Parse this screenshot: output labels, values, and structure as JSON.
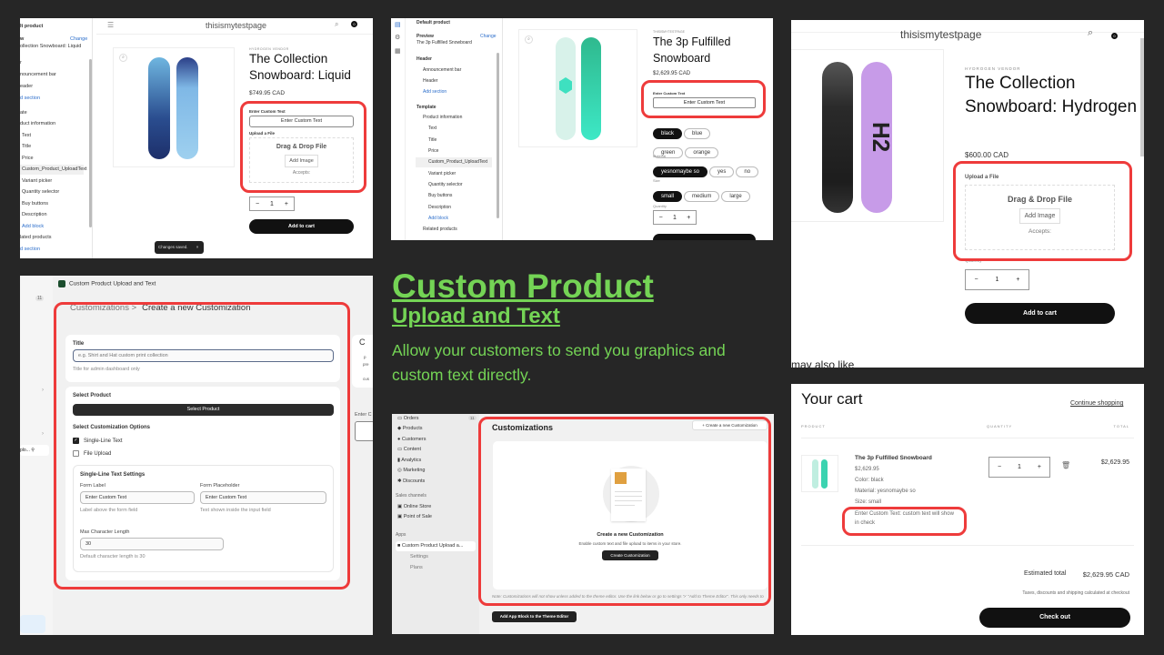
{
  "headline": {
    "title": "Custom Product",
    "subtitle": "Upload and Text",
    "description": "Allow your customers to send you graphics and custom text directly.",
    "accent_color": "#74d455"
  },
  "panel1": {
    "sidebar": {
      "heading": "lt product",
      "preview_label": "w",
      "change": "Change",
      "preview_value": "ollection Snowboard: Liquid",
      "header": "r",
      "items": [
        "nouncement bar",
        "eader",
        "d section",
        "ate",
        "duct information",
        "Text",
        "Title",
        "Price",
        "Custom_Product_UploadText",
        "Variant picker",
        "Quantity selector",
        "Buy buttons",
        "Description",
        "Add block",
        "lated products",
        "d section"
      ]
    },
    "store_name": "thisismytestpage",
    "cart_count": "0",
    "vendor": "HYDROGEN VENDOR",
    "product_title": "The Collection Snowboard: Liquid",
    "price": "$749.95 CAD",
    "custom_text_label": "Enter Custom Text",
    "custom_text_placeholder": "Enter Custom Text",
    "upload_label": "Upload a File",
    "drop_heading": "Drag & Drop File",
    "add_image": "Add Image",
    "accepts": "Accepts:",
    "quantity": "1",
    "minus": "−",
    "plus": "+",
    "add_to_cart": "Add to cart",
    "toast": "Changes saved.",
    "toast_close": "×"
  },
  "panel2": {
    "sidebar": {
      "heading": "Default product",
      "preview_label": "Preview",
      "change": "Change",
      "preview_value": "The 3p Fulfilled Snowboard",
      "header_group": "Header",
      "header_items": [
        "Announcement bar",
        "Header"
      ],
      "add_section": "Add section",
      "template_group": "Template",
      "template_parent": "Product information",
      "blocks": [
        "Text",
        "Title",
        "Price",
        "Custom_Product_UploadText",
        "Variant picker",
        "Quantity selector",
        "Buy buttons",
        "Description"
      ],
      "add_block": "Add block",
      "related": "Related products"
    },
    "vendor": "THISISMYTESTPAGE",
    "product_title": "The 3p Fulfilled Snowboard",
    "price": "$2,629.95 CAD",
    "custom_text_label": "Enter Custom Text",
    "custom_text_placeholder": "Enter Custom Text",
    "color_label": "Color",
    "colors": [
      "black",
      "blue",
      "green",
      "orange"
    ],
    "selected_color": "black",
    "material_label": "Material",
    "materials": [
      "yesnomaybe so",
      "yes",
      "no"
    ],
    "selected_material": "yesnomaybe so",
    "size_label": "Size",
    "sizes": [
      "small",
      "medium",
      "large"
    ],
    "selected_size": "small",
    "quantity_label": "Quantity",
    "quantity": "1",
    "minus": "−",
    "plus": "+"
  },
  "panel3": {
    "store_name": "thisismytestpage",
    "cart_count": "0",
    "vendor": "HYDROGEN VENDOR",
    "product_title": "The Collection Snowboard: Hydrogen",
    "price": "$600.00 CAD",
    "upload_label": "Upload a File",
    "drop_heading": "Drag & Drop File",
    "add_image": "Add Image",
    "accepts": "Accepts:",
    "quantity_label": "Quantity",
    "quantity": "1",
    "minus": "−",
    "plus": "+",
    "add_to_cart": "Add to cart",
    "also_like": "may also like"
  },
  "panel4": {
    "app_name": "Custom Product Upload and Text",
    "nav_badge": "11",
    "nav_truncated": "plo...",
    "breadcrumb_parent": "Customizations >",
    "breadcrumb_current": "Create a new Customization",
    "title_label": "Title",
    "title_placeholder": "e.g. Shirt and Hat custom print collection",
    "title_hint": "Title for admin dashboard only",
    "select_product_label": "Select Product",
    "select_product_button": "Select Product",
    "options_label": "Select Customization Options",
    "options": [
      {
        "label": "Single-Line Text",
        "checked": true
      },
      {
        "label": "File Upload",
        "checked": false
      }
    ],
    "settings_title": "Single-Line Text Settings",
    "form_label_label": "Form Label",
    "form_label_value": "Enter Custom Text",
    "form_label_hint": "Label above the form field",
    "form_placeholder_label": "Form Placeholder",
    "form_placeholder_value": "Enter Custom Text",
    "form_placeholder_hint": "Text shown inside the input field",
    "max_len_label": "Max Character Length",
    "max_len_value": "30",
    "max_len_hint": "Default character length is 30",
    "side_peek": [
      "C",
      "p",
      "pre",
      "cus",
      "Enter C"
    ]
  },
  "panel5": {
    "nav": [
      "Orders",
      "Products",
      "Customers",
      "Content",
      "Analytics",
      "Marketing",
      "Discounts"
    ],
    "orders_badge": "11",
    "sales_channels": "Sales channels",
    "channels": [
      "Online Store",
      "Point of Sale"
    ],
    "apps_label": "Apps",
    "app_item": "Custom Product Upload a...",
    "app_sub": [
      "Settings",
      "Plans"
    ],
    "title": "Customizations",
    "new_button": "+ Create a new Customization",
    "empty_title": "Create a new Customization",
    "empty_sub": "Enable custom text and file upload to items in your store.",
    "empty_button": "Create Customization",
    "note": "Note: Customizations will not show unless added to the theme editor. Use the link below or go to settings '>' \"Add to Theme Editor\". This only needs to be added and saved once to the Theme Editor.",
    "block_button": "Add App Block to the Theme Editor"
  },
  "panel6": {
    "title": "Your cart",
    "continue": "Continue shopping",
    "col_product": "PRODUCT",
    "col_quantity": "QUANTITY",
    "col_total": "TOTAL",
    "item": {
      "name": "The 3p Fulfilled Snowboard",
      "price": "$2,629.95",
      "color": "Color: black",
      "material": "Material: yesnomaybe so",
      "size": "Size: small",
      "custom_text": "Enter Custom Text: custom text will show in check",
      "quantity": "1",
      "line_total": "$2,629.95"
    },
    "minus": "−",
    "plus": "+",
    "estimated_label": "Estimated total",
    "estimated_value": "$2,629.95 CAD",
    "tax_note": "Taxes, discounts and shipping calculated at checkout",
    "checkout": "Check out"
  }
}
